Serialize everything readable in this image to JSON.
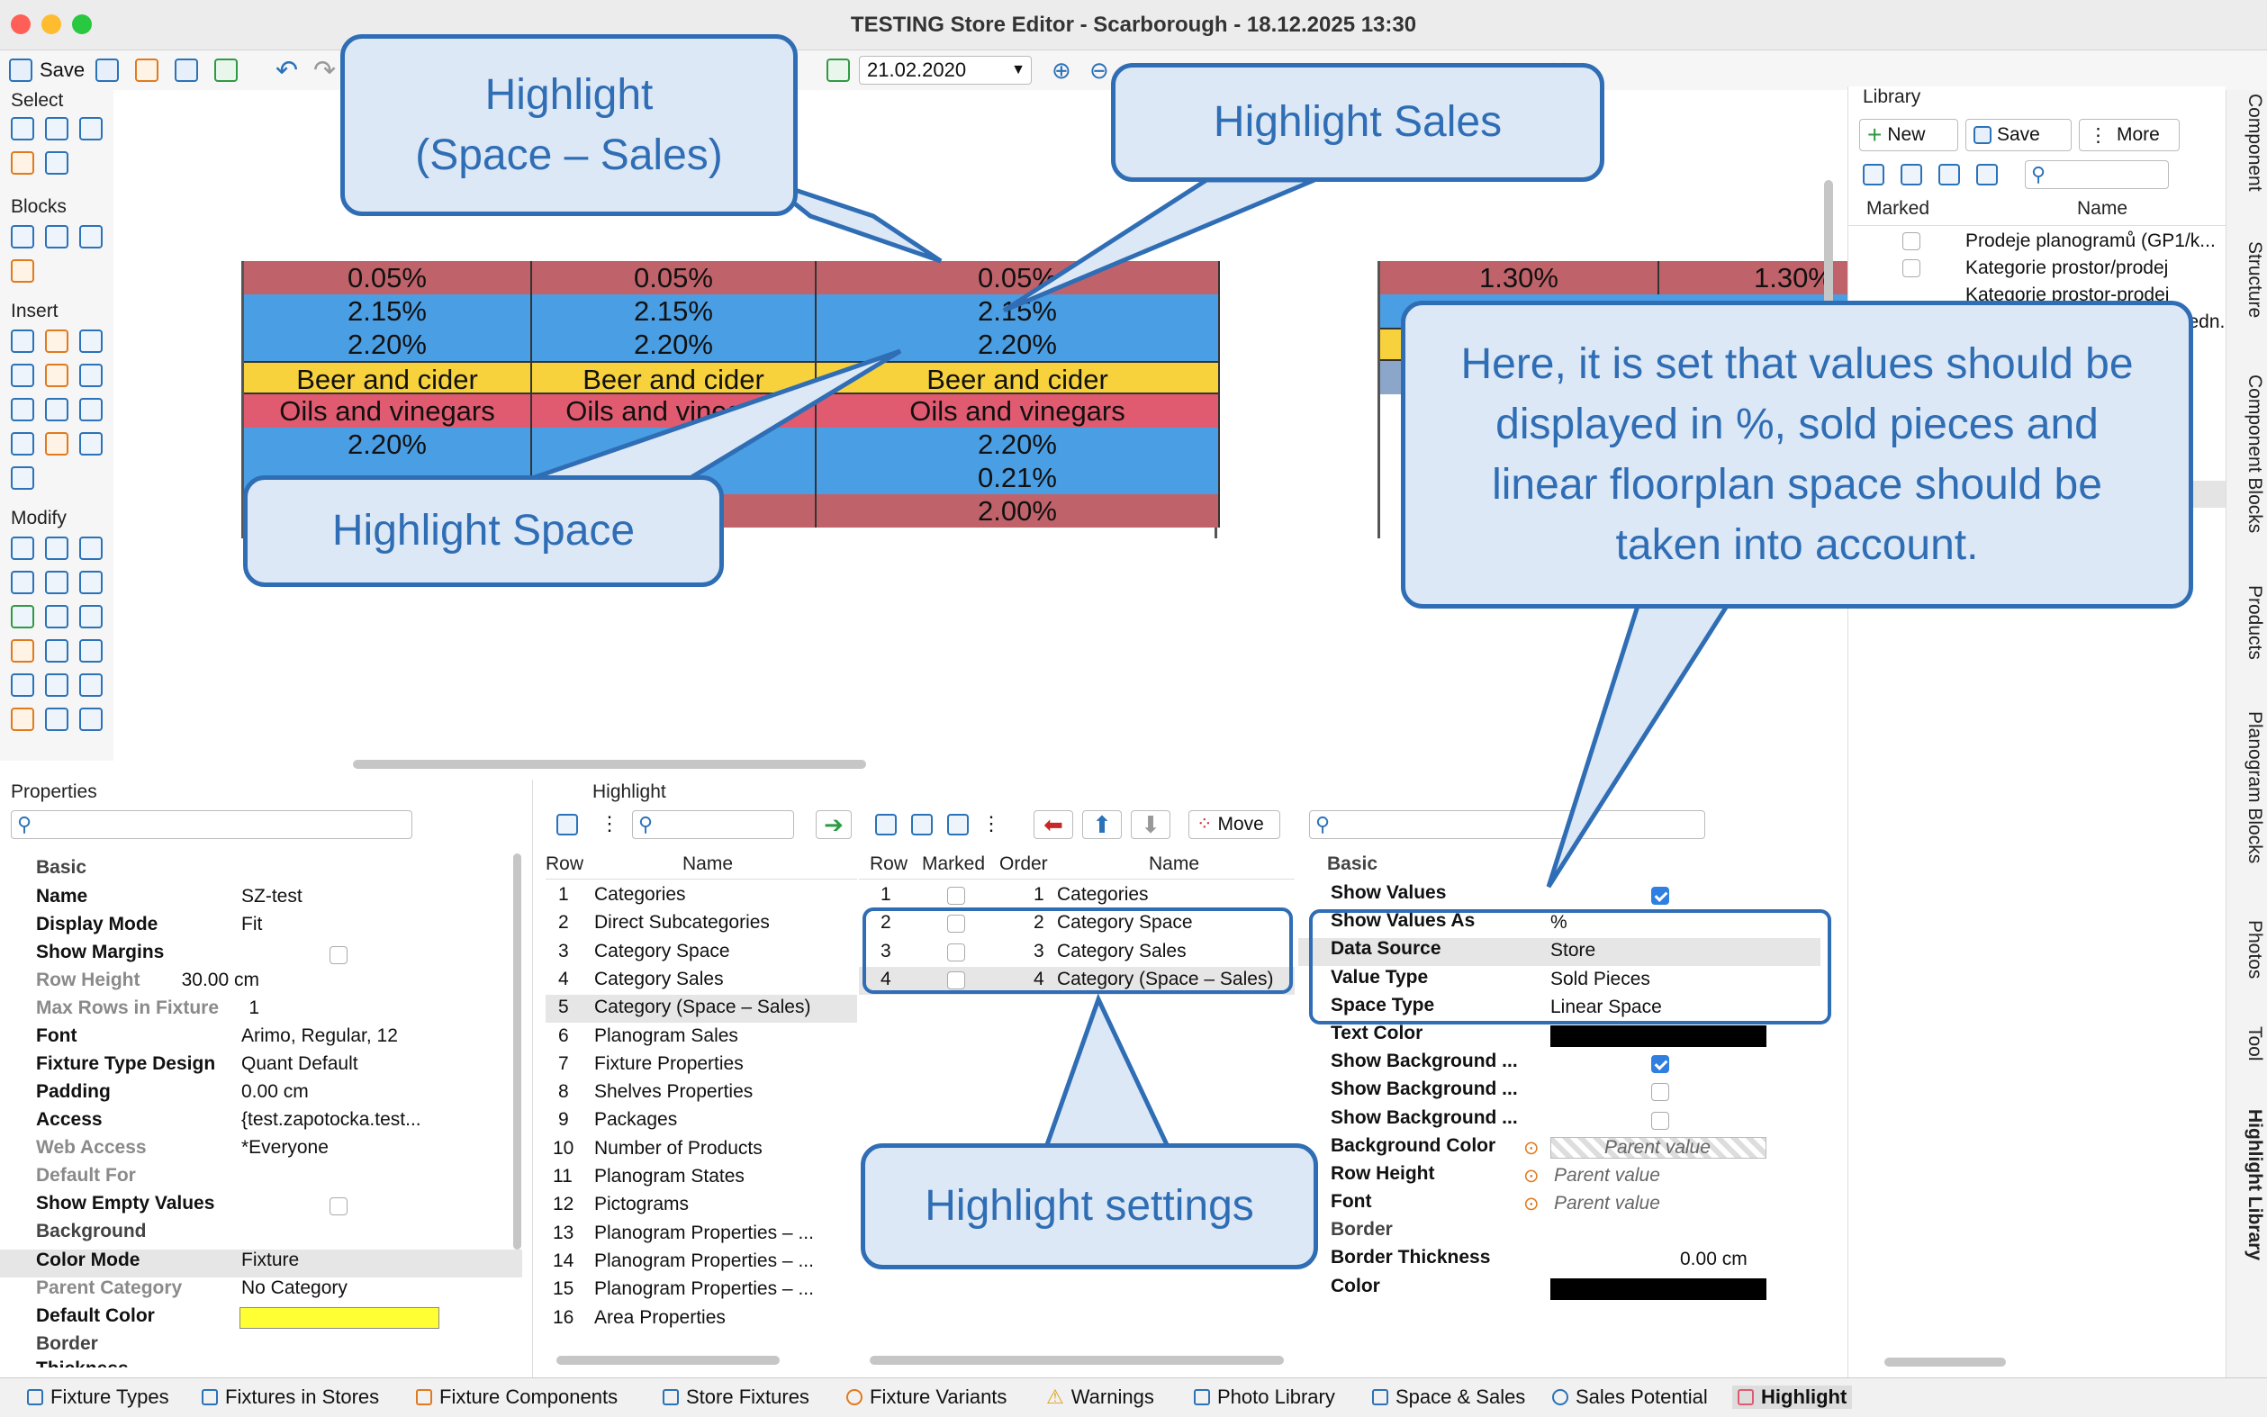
{
  "window": {
    "title": "TESTING Store Editor - Scarborough - 18.12.2025 13:30"
  },
  "toolbar": {
    "save_label": "Save",
    "date_value": "21.02.2020"
  },
  "left_tools": {
    "select": "Select",
    "blocks": "Blocks",
    "insert": "Insert",
    "modify": "Modify"
  },
  "canvas": {
    "left_cols": [
      [
        "0.05%",
        "2.15%",
        "2.20%",
        "Beer and cider",
        "Oils and vinegars",
        "2.20%",
        "",
        ""
      ],
      [
        "0.05%",
        "2.15%",
        "2.20%",
        "Beer and cider",
        "Oils and vinegars",
        "",
        "",
        ""
      ],
      [
        "0.05%",
        "2.15%",
        "2.20%",
        "Beer and cider",
        "Oils and vinegars",
        "2.20%",
        "0.21%",
        "2.00%"
      ]
    ],
    "right_cells": [
      "1.30%",
      "1.30%"
    ],
    "right_cols": [
      [
        "1.30%"
      ],
      [
        "1.30%"
      ]
    ]
  },
  "callouts": {
    "space_sales": "Highlight\n(Space – Sales)",
    "sales": "Highlight Sales",
    "space": "Highlight Space",
    "note": "Here, it is set that values should be displayed in %, sold pieces and linear floorplan space should be taken into account.",
    "settings": "Highlight settings"
  },
  "library": {
    "title": "Library",
    "new_label": "New",
    "save_label": "Save",
    "more_label": "More",
    "col_marked": "Marked",
    "col_name": "Name",
    "items": [
      "Prodeje planogramů (GP1/k...",
      "Kategorie prostor/prodej",
      "Kategorie prostor-prodej",
      "...edn..."
    ]
  },
  "properties": {
    "title": "Properties",
    "basic": "Basic",
    "rows": [
      {
        "k": "Name",
        "v": "SZ-test"
      },
      {
        "k": "Display Mode",
        "v": "Fit"
      },
      {
        "k": "Show Margins",
        "v": ""
      },
      {
        "k": "Row Height",
        "v": "30.00 cm"
      },
      {
        "k": "Max Rows in Fixture",
        "v": "1"
      },
      {
        "k": "Font",
        "v": "Arimo, Regular, 12"
      },
      {
        "k": "Fixture Type Design",
        "v": "Quant Default"
      },
      {
        "k": "Padding",
        "v": "0.00 cm"
      },
      {
        "k": "Access",
        "v": "{test.zapotocka.test..."
      },
      {
        "k": "Web Access",
        "v": "*Everyone"
      },
      {
        "k": "Default For",
        "v": ""
      },
      {
        "k": "Show Empty Values",
        "v": ""
      }
    ],
    "background": "Background",
    "bg_rows": [
      {
        "k": "Color Mode",
        "v": "Fixture"
      },
      {
        "k": "Parent Category",
        "v": "No Category"
      },
      {
        "k": "Default Color",
        "v": ""
      }
    ],
    "border": "Border",
    "thickness_partial": "Thickness"
  },
  "highlight": {
    "title": "Highlight",
    "col_row": "Row",
    "col_name": "Name",
    "items": [
      "Categories",
      "Direct Subcategories",
      "Category Space",
      "Category Sales",
      "Category (Space – Sales)",
      "Planogram Sales",
      "Fixture Properties",
      "Shelves Properties",
      "Packages",
      "Number of Products",
      "Planogram States",
      "Pictograms",
      "Planogram Properties – ...",
      "Planogram Properties – ...",
      "Planogram Properties – ...",
      "Area Properties"
    ]
  },
  "marked": {
    "move_label": "Move",
    "col_row": "Row",
    "col_marked": "Marked",
    "col_order": "Order",
    "col_name": "Name",
    "items": [
      {
        "row": "1",
        "order": "1",
        "name": "Categories"
      },
      {
        "row": "2",
        "order": "2",
        "name": "Category Space"
      },
      {
        "row": "3",
        "order": "3",
        "name": "Category Sales"
      },
      {
        "row": "4",
        "order": "4",
        "name": "Category (Space – Sales)"
      }
    ]
  },
  "settings": {
    "basic": "Basic",
    "rows": [
      {
        "k": "Show Values",
        "v": ""
      },
      {
        "k": "Show Values As",
        "v": "%"
      },
      {
        "k": "Data Source",
        "v": "Store"
      },
      {
        "k": "Value Type",
        "v": "Sold Pieces"
      },
      {
        "k": "Space Type",
        "v": "Linear Space"
      },
      {
        "k": "Text Color",
        "v": ""
      },
      {
        "k": "Show Background ...",
        "v": ""
      },
      {
        "k": "Show Background ...",
        "v": ""
      },
      {
        "k": "Show Background ...",
        "v": ""
      },
      {
        "k": "Background Color",
        "v": "Parent value"
      },
      {
        "k": "Row Height",
        "v": "Parent value"
      },
      {
        "k": "Font",
        "v": "Parent value"
      }
    ],
    "border": "Border",
    "border_rows": [
      {
        "k": "Border Thickness",
        "v": "0.00 cm"
      },
      {
        "k": "Color",
        "v": ""
      }
    ]
  },
  "right_tabs": [
    "Component",
    "Structure",
    "Component Blocks",
    "Products",
    "Planogram Blocks",
    "Photos",
    "Tool",
    "Highlight Library"
  ],
  "bottom_tabs": [
    "Fixture Types",
    "Fixtures in Stores",
    "Fixture Components",
    "Store Fixtures",
    "Fixture Variants",
    "Warnings",
    "Photo Library",
    "Space & Sales",
    "Sales Potential",
    "Highlight"
  ],
  "colors": {
    "accent": "#2f6db5",
    "red_row": "#c0626a",
    "blue_row": "#4a9ee4",
    "yellow_row": "#f7d23c",
    "pink_row": "#e05a70",
    "default_color": "#ffff33"
  }
}
